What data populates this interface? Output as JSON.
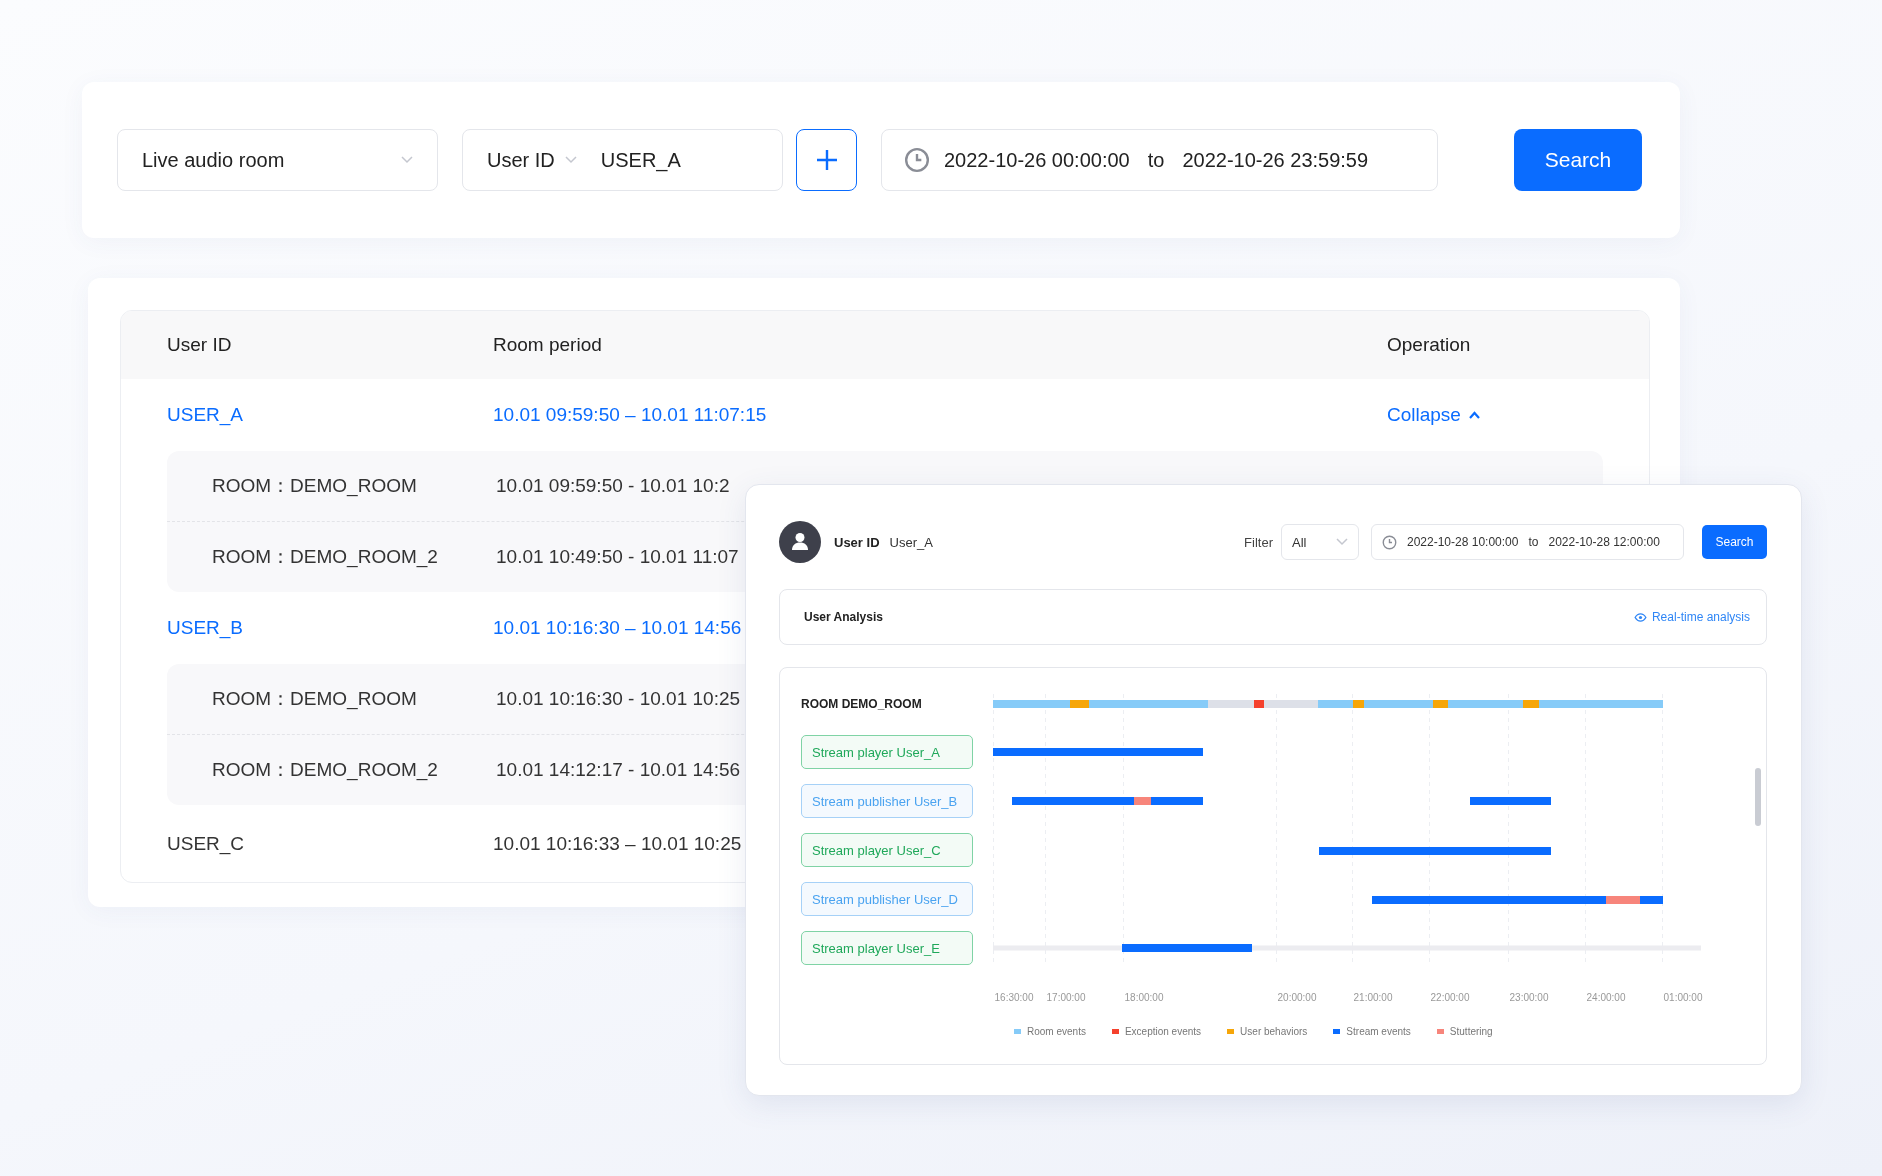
{
  "query_bar": {
    "room_type": {
      "value": "Live audio room"
    },
    "user_filter": {
      "field": "User ID",
      "value": "USER_A"
    },
    "date_range": {
      "start": "2022-10-26 00:00:00",
      "separator": "to",
      "end": "2022-10-26 23:59:59"
    },
    "search_button": "Search"
  },
  "table": {
    "columns": [
      "User ID",
      "Room period",
      "Operation"
    ],
    "rows": [
      {
        "user": "USER_A",
        "kind": "link",
        "period": "10.01 09:59:50 – 10.01 11:07:15",
        "operation": "Collapse",
        "expanded": true,
        "children": [
          {
            "room": "ROOM：DEMO_ROOM",
            "period": "10.01 09:59:50 - 10.01 10:2"
          },
          {
            "room": "ROOM：DEMO_ROOM_2",
            "period": "10.01 10:49:50 - 10.01 11:07"
          }
        ]
      },
      {
        "user": "USER_B",
        "kind": "link",
        "period": "10.01 10:16:30 – 10.01 14:56",
        "children": [
          {
            "room": "ROOM：DEMO_ROOM",
            "period": "10.01 10:16:30 - 10.01 10:25"
          },
          {
            "room": "ROOM：DEMO_ROOM_2",
            "period": "10.01 14:12:17 - 10.01 14:56"
          }
        ]
      },
      {
        "user": "USER_C",
        "kind": "plain",
        "period": "10.01 10:16:33 – 10.01 10:25"
      }
    ]
  },
  "detail_panel": {
    "user_label": "User ID",
    "user_value": "User_A",
    "filter_label": "Filter",
    "filter_value": "All",
    "date_range": {
      "start": "2022-10-28 10:00:00",
      "separator": "to",
      "end": "2022-10-28 12:00:00"
    },
    "search_button": "Search",
    "analysis": {
      "title": "User Analysis",
      "link": "Real-time analysis"
    },
    "timeline": {
      "room_label": "ROOM DEMO_ROOM",
      "tracks": [
        {
          "label": "Stream player User_A",
          "kind": "player"
        },
        {
          "label": "Stream publisher User_B",
          "kind": "publisher"
        },
        {
          "label": "Stream player User_C",
          "kind": "player"
        },
        {
          "label": "Stream publisher User_D",
          "kind": "publisher"
        },
        {
          "label": "Stream player User_E",
          "kind": "player"
        }
      ],
      "ticks": [
        "16:30:00",
        "17:00:00",
        "18:00:00",
        "20:00:00",
        "21:00:00",
        "22:00:00",
        "23:00:00",
        "24:00:00",
        "01:00:00"
      ],
      "legend": [
        {
          "label": "Room events",
          "color": "#86cbf8"
        },
        {
          "label": "Exception events",
          "color": "#f5412d"
        },
        {
          "label": "User behaviors",
          "color": "#f6a609"
        },
        {
          "label": "Stream events",
          "color": "#0a6cff"
        },
        {
          "label": "Stuttering",
          "color": "#f7857b"
        }
      ]
    }
  }
}
